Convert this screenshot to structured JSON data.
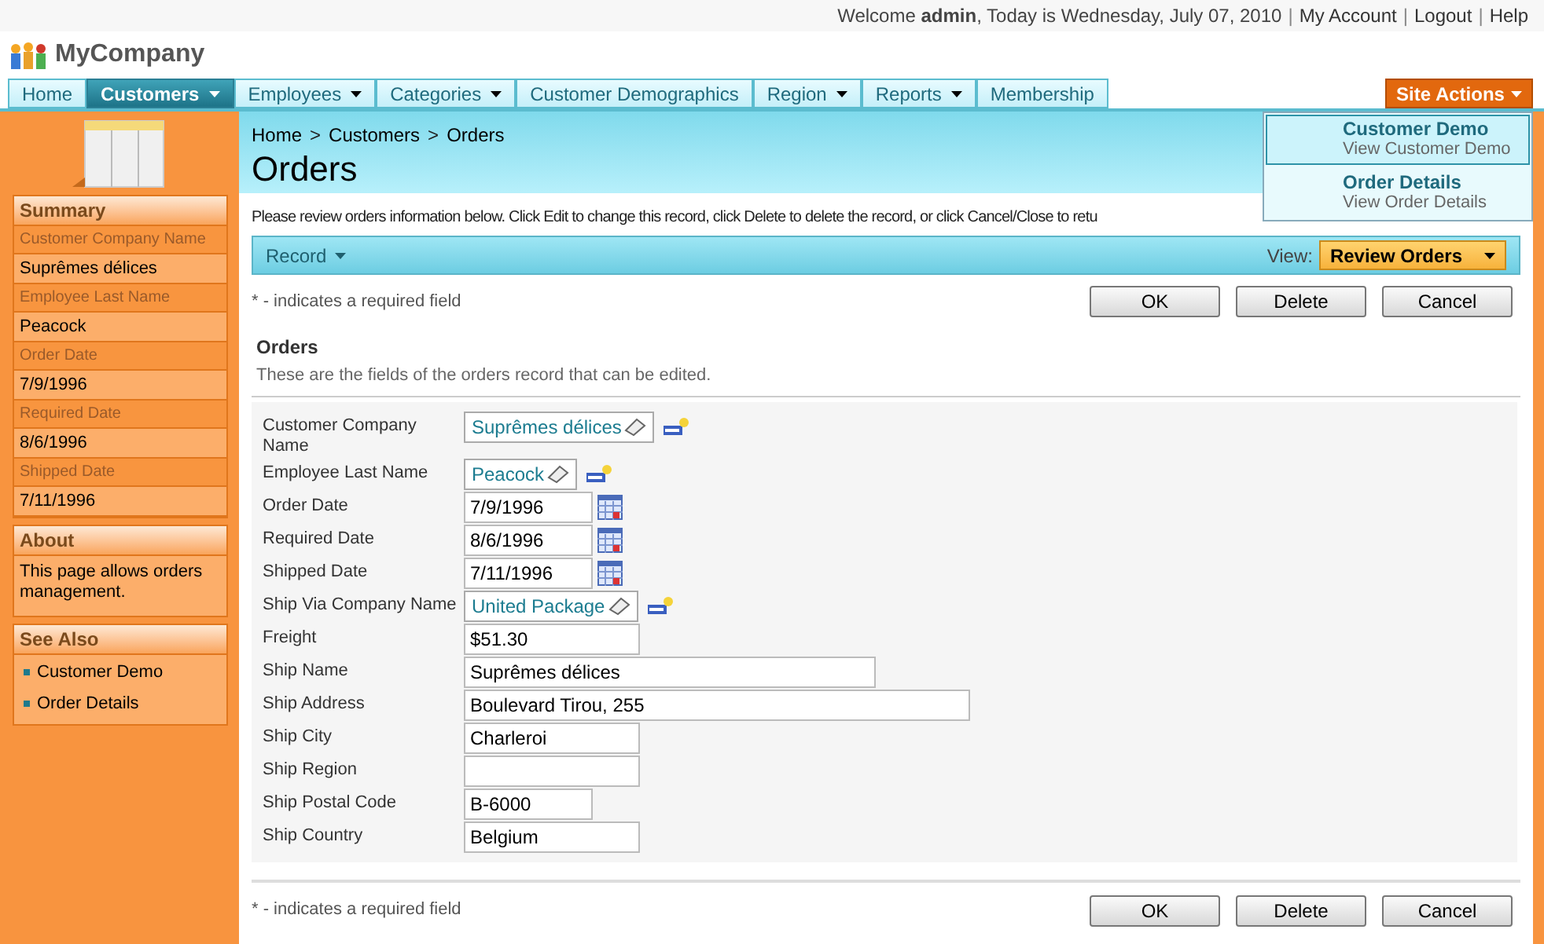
{
  "top_bar": {
    "welcome": "Welcome **admin**, Today is Wednesday, July 07, 2010",
    "separator": "|",
    "links": [
      "My Account",
      "Logout",
      "Help"
    ]
  },
  "logo": {
    "text": "MyCompany"
  },
  "nav": {
    "tabs": [
      {
        "label": "Home",
        "selected": false,
        "has_menu": false
      },
      {
        "label": "Customers",
        "selected": true,
        "has_menu": true
      },
      {
        "label": "Employees",
        "selected": false,
        "has_menu": true
      },
      {
        "label": "Categories",
        "selected": false,
        "has_menu": true
      },
      {
        "label": "Customer Demographics",
        "selected": false,
        "has_menu": false
      },
      {
        "label": "Region",
        "selected": false,
        "has_menu": true
      },
      {
        "label": "Reports",
        "selected": false,
        "has_menu": true
      },
      {
        "label": "Membership",
        "selected": false,
        "has_menu": false
      }
    ],
    "site_actions": "Site Actions"
  },
  "site_actions_menu": [
    {
      "title": "Customer Demo",
      "subtitle": "View Customer Demo",
      "selected": true
    },
    {
      "title": "Order Details",
      "subtitle": "View Order Details",
      "selected": false
    }
  ],
  "sidebar": {
    "summary": {
      "title": "Summary",
      "fields": [
        {
          "label": "Customer Company Name",
          "value": "Suprêmes délices"
        },
        {
          "label": "Employee Last Name",
          "value": "Peacock"
        },
        {
          "label": "Order Date",
          "value": "7/9/1996"
        },
        {
          "label": "Required Date",
          "value": "8/6/1996"
        },
        {
          "label": "Shipped Date",
          "value": "7/11/1996"
        }
      ]
    },
    "about": {
      "title": "About",
      "text": "This page allows orders management."
    },
    "see_also": {
      "title": "See Also",
      "links": [
        "Customer Demo",
        "Order Details"
      ]
    }
  },
  "page": {
    "breadcrumb": [
      "Home",
      "Customers",
      "Orders"
    ],
    "breadcrumb_separator": ">",
    "title": "Orders",
    "instructions": "Please review orders information below. Click Edit to change this record, click Delete to delete the record, or click Cancel/Close to retu",
    "toolbar": {
      "record_menu": "Record",
      "view_label": "View:",
      "view": "Review Orders"
    },
    "required_note": "* - indicates a required field",
    "buttons": [
      "OK",
      "Delete",
      "Cancel"
    ],
    "section": {
      "title": "Orders",
      "description": "These are the fields of the orders record that can be edited."
    },
    "fields": [
      {
        "label": "Customer Company Name",
        "value": "Suprêmes délices",
        "kind": "lookup"
      },
      {
        "label": "Employee Last Name",
        "value": "Peacock",
        "kind": "lookup"
      },
      {
        "label": "Order Date",
        "value": "7/9/1996",
        "kind": "date"
      },
      {
        "label": "Required Date",
        "value": "8/6/1996",
        "kind": "date"
      },
      {
        "label": "Shipped Date",
        "value": "7/11/1996",
        "kind": "date"
      },
      {
        "label": "Ship Via Company Name",
        "value": "United Package",
        "kind": "lookup"
      },
      {
        "label": "Freight",
        "value": "$51.30",
        "kind": "text"
      },
      {
        "label": "Ship Name",
        "value": "Suprêmes délices",
        "kind": "text"
      },
      {
        "label": "Ship Address",
        "value": "Boulevard Tirou, 255",
        "kind": "text"
      },
      {
        "label": "Ship City",
        "value": "Charleroi",
        "kind": "text"
      },
      {
        "label": "Ship Region",
        "kind": "text"
      },
      {
        "label": "Ship Postal Code",
        "value": "B-6000",
        "kind": "text"
      },
      {
        "label": "Ship Country",
        "value": "Belgium",
        "kind": "text"
      }
    ],
    "footer": {
      "required_note": "* - indicates a required field",
      "buttons": [
        "OK",
        "Delete",
        "Cancel"
      ]
    }
  }
}
